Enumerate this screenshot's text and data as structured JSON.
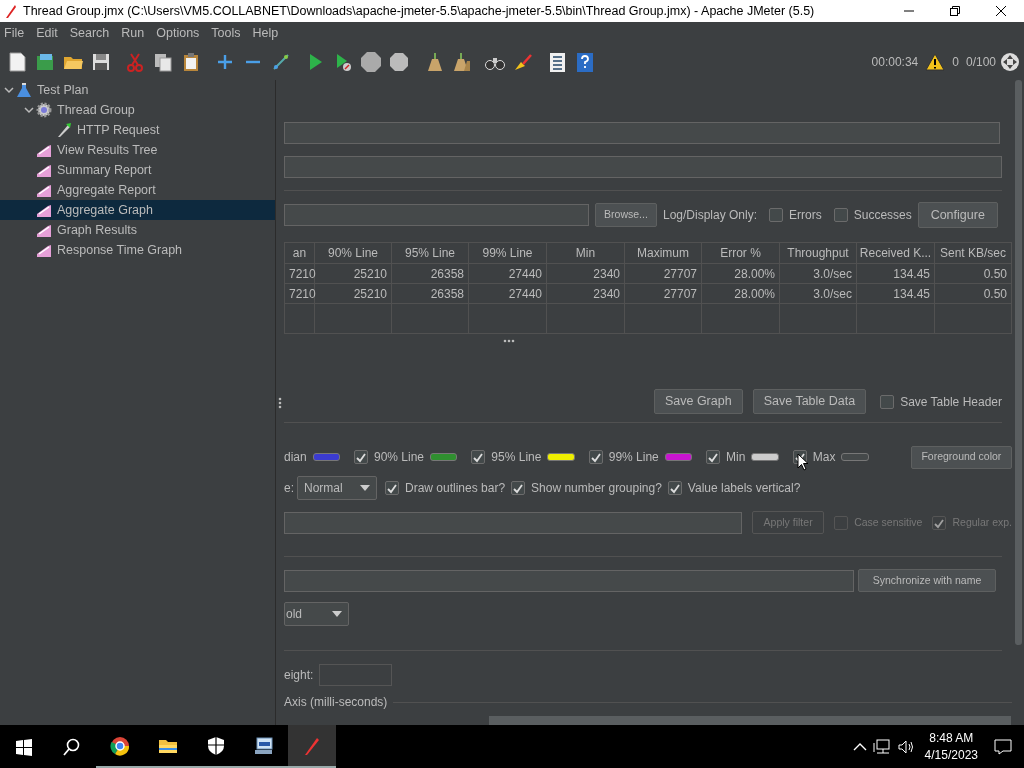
{
  "window": {
    "title": "Thread Group.jmx (C:\\Users\\VM5.COLLABNET\\Downloads\\apache-jmeter-5.5\\apache-jmeter-5.5\\bin\\Thread Group.jmx) - Apache JMeter (5.5)"
  },
  "menu": [
    "File",
    "Edit",
    "Search",
    "Run",
    "Options",
    "Tools",
    "Help"
  ],
  "toolbar": {
    "elapsed": "00:00:34",
    "warnings": "0",
    "threads": "0/100"
  },
  "tree": [
    {
      "label": "Test Plan",
      "kind": "plan",
      "expanded": true,
      "selected": false,
      "children": [
        {
          "label": "Thread Group",
          "kind": "threads",
          "expanded": true,
          "selected": false,
          "children": [
            {
              "label": "HTTP Request",
              "kind": "sampler",
              "expanded": false,
              "selected": false
            }
          ]
        },
        {
          "label": "View Results Tree",
          "kind": "listener",
          "expanded": false,
          "selected": false
        },
        {
          "label": "Summary Report",
          "kind": "listener",
          "expanded": false,
          "selected": false
        },
        {
          "label": "Aggregate Report",
          "kind": "listener",
          "expanded": false,
          "selected": false
        },
        {
          "label": "Aggregate Graph",
          "kind": "listener",
          "expanded": false,
          "selected": true
        },
        {
          "label": "Graph Results",
          "kind": "listener",
          "expanded": false,
          "selected": false
        },
        {
          "label": "Response Time Graph",
          "kind": "listener",
          "expanded": false,
          "selected": false
        }
      ]
    }
  ],
  "file_row": {
    "browse": "Browse...",
    "log_label": "Log/Display Only:",
    "options": [
      {
        "label": "Errors",
        "checked": false
      },
      {
        "label": "Successes",
        "checked": false
      }
    ],
    "configure": "Configure"
  },
  "table": {
    "columns": [
      "an",
      "90% Line",
      "95% Line",
      "99% Line",
      "Min",
      "Maximum",
      "Error %",
      "Throughput",
      "Received K...",
      "Sent KB/sec"
    ],
    "rows": [
      [
        "7210",
        "25210",
        "26358",
        "27440",
        "2340",
        "27707",
        "28.00%",
        "3.0/sec",
        "134.45",
        "0.50"
      ],
      [
        "7210",
        "25210",
        "26358",
        "27440",
        "2340",
        "27707",
        "28.00%",
        "3.0/sec",
        "134.45",
        "0.50"
      ]
    ]
  },
  "save_row": {
    "buttons": [
      "Save Graph",
      "Save Table Data"
    ],
    "header_option": {
      "label": "Save Table Header",
      "checked": false
    }
  },
  "series_first": {
    "label": "dian",
    "color": "#3b3bd0"
  },
  "series": [
    {
      "label": "90% Line",
      "checked": true,
      "color": "#2f8f2f"
    },
    {
      "label": "95% Line",
      "checked": true,
      "color": "#eeee00"
    },
    {
      "label": "99% Line",
      "checked": true,
      "color": "#c815d0"
    },
    {
      "label": "Min",
      "checked": true,
      "color": "#cccccc"
    },
    {
      "label": "Max",
      "checked": true,
      "color": "#45494a"
    }
  ],
  "foreground_button": "Foreground color",
  "options_row": {
    "label": "e:",
    "select": "Normal",
    "options": [
      {
        "label": "Draw outlines bar?",
        "checked": true
      },
      {
        "label": "Show number grouping?",
        "checked": true
      },
      {
        "label": "Value labels vertical?",
        "checked": true
      }
    ]
  },
  "filter_row": {
    "apply": "Apply filter",
    "apply_disabled": true,
    "options": [
      {
        "label": "Case sensitive",
        "checked": false,
        "disabled": true
      },
      {
        "label": "Regular exp.",
        "checked": true,
        "disabled": true
      }
    ]
  },
  "sync_button": "Synchronize with name",
  "font_select": "old",
  "height_label": "eight:",
  "axis_label": "Axis (milli-seconds)",
  "taskbar": {
    "time": "8:48 AM",
    "date": "4/15/2023"
  }
}
